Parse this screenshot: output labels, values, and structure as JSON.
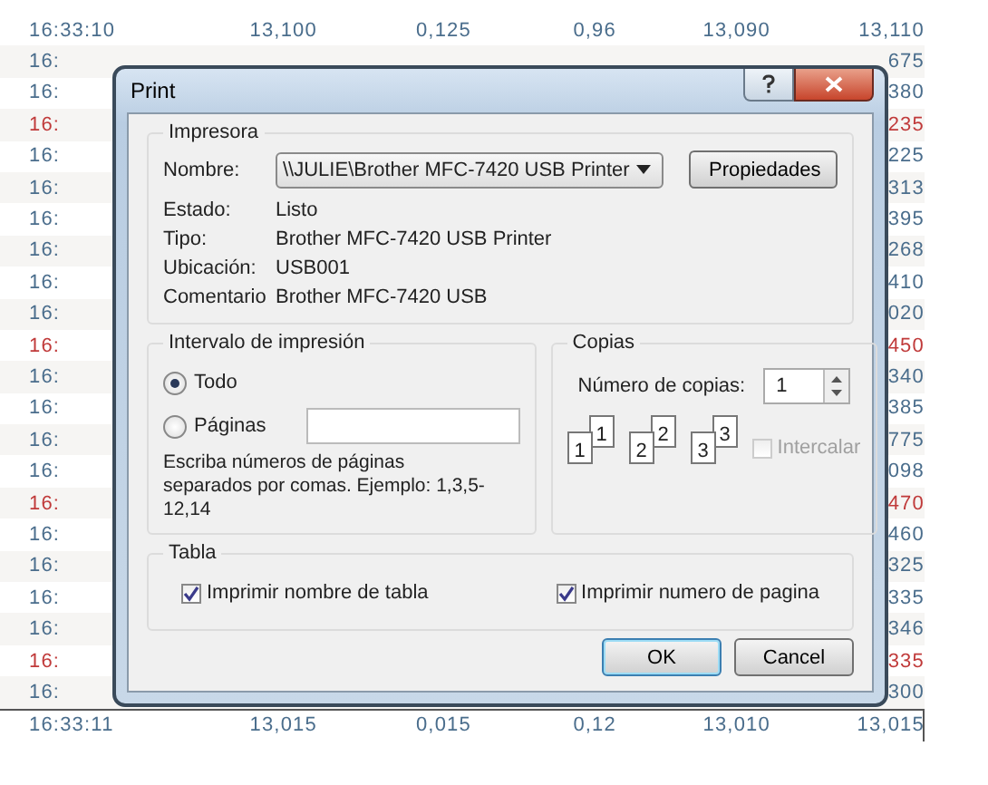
{
  "table": {
    "rows": [
      {
        "cells": [
          "16:33:10",
          "13,100",
          "0,125",
          "0,96",
          "13,090",
          "13,110"
        ],
        "color": "#4a6d8c"
      },
      {
        "cells": [
          "16:",
          "675"
        ],
        "color": "#4a6d8c"
      },
      {
        "cells": [
          "16:",
          "380"
        ],
        "color": "#4a6d8c"
      },
      {
        "cells": [
          "16:",
          "235"
        ],
        "color": "#c03a3a"
      },
      {
        "cells": [
          "16:",
          "225"
        ],
        "color": "#4a6d8c"
      },
      {
        "cells": [
          "16:",
          "313"
        ],
        "color": "#4a6d8c"
      },
      {
        "cells": [
          "16:",
          "395"
        ],
        "color": "#4a6d8c"
      },
      {
        "cells": [
          "16:",
          "268"
        ],
        "color": "#4a6d8c"
      },
      {
        "cells": [
          "16:",
          "410"
        ],
        "color": "#4a6d8c"
      },
      {
        "cells": [
          "16:",
          "020"
        ],
        "color": "#4a6d8c"
      },
      {
        "cells": [
          "16:",
          "450"
        ],
        "color": "#c03a3a"
      },
      {
        "cells": [
          "16:",
          "340"
        ],
        "color": "#4a6d8c"
      },
      {
        "cells": [
          "16:",
          "385"
        ],
        "color": "#4a6d8c"
      },
      {
        "cells": [
          "16:",
          "775"
        ],
        "color": "#4a6d8c"
      },
      {
        "cells": [
          "16:",
          "098"
        ],
        "color": "#4a6d8c"
      },
      {
        "cells": [
          "16:",
          "470"
        ],
        "color": "#c03a3a"
      },
      {
        "cells": [
          "16:",
          "460"
        ],
        "color": "#4a6d8c"
      },
      {
        "cells": [
          "16:",
          "325"
        ],
        "color": "#4a6d8c"
      },
      {
        "cells": [
          "16:",
          "335"
        ],
        "color": "#4a6d8c"
      },
      {
        "cells": [
          "16:",
          "346"
        ],
        "color": "#4a6d8c"
      },
      {
        "cells": [
          "16:",
          "335"
        ],
        "color": "#c03a3a"
      },
      {
        "cells": [
          "16:",
          "300"
        ],
        "color": "#4a6d8c"
      },
      {
        "cells": [
          "16:33:11",
          "13,015",
          "0,015",
          "0,12",
          "13,010",
          "13,015"
        ],
        "color": "#4a6d8c"
      }
    ]
  },
  "dialog": {
    "title": "Print",
    "printer": {
      "title": "Impresora",
      "name_label": "Nombre:",
      "name_value": "\\\\JULIE\\Brother MFC-7420 USB Printer",
      "properties_button": "Propiedades",
      "info": [
        {
          "label": "Estado:",
          "value": "Listo"
        },
        {
          "label": "Tipo:",
          "value": "Brother MFC-7420 USB Printer"
        },
        {
          "label": "Ubicación:",
          "value": "USB001"
        },
        {
          "label": "Comentario",
          "value": "Brother MFC-7420 USB"
        }
      ]
    },
    "range": {
      "title": "Intervalo de impresión",
      "options": [
        {
          "label": "Todo",
          "selected": true
        },
        {
          "label": "Páginas",
          "selected": false
        }
      ],
      "hint": "Escriba números de páginas separados por comas. Ejemplo: 1,3,5-12,14"
    },
    "copies": {
      "title": "Copias",
      "count_label": "Número de copias:",
      "count_value": "1",
      "page_stacks": [
        [
          "1",
          "1"
        ],
        [
          "2",
          "2"
        ],
        [
          "3",
          "3"
        ]
      ],
      "collate": {
        "label": "Intercalar",
        "checked": false,
        "disabled": true
      }
    },
    "table_options": {
      "title": "Tabla",
      "options": [
        {
          "label": "Imprimir nombre de tabla",
          "checked": true
        },
        {
          "label": "Imprimir numero de pagina",
          "checked": true
        }
      ]
    },
    "buttons": [
      {
        "label": "OK",
        "default": true
      },
      {
        "label": "Cancel",
        "default": false
      }
    ]
  }
}
